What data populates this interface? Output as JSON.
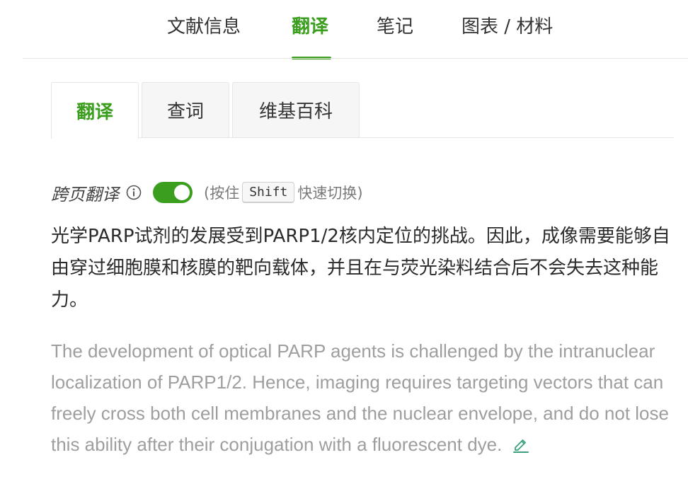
{
  "top_tabs": {
    "items": [
      {
        "label": "文献信息"
      },
      {
        "label": "翻译"
      },
      {
        "label": "笔记"
      },
      {
        "label": "图表 / 材料"
      }
    ],
    "active_index": 1
  },
  "sub_tabs": {
    "items": [
      {
        "label": "翻译"
      },
      {
        "label": "查词"
      },
      {
        "label": "维基百科"
      }
    ],
    "active_index": 0
  },
  "cross_page": {
    "label": "跨页翻译",
    "enabled": true,
    "hint_prefix": "(按住",
    "key": "Shift",
    "hint_suffix": "快速切换)"
  },
  "translation": {
    "chinese": "光学PARP试剂的发展受到PARP1/2核内定位的挑战。因此，成像需要能够自由穿过细胞膜和核膜的靶向载体，并且在与荧光染料结合后不会失去这种能力。",
    "english": "The development of optical PARP agents is challenged by the intranuclear localization of PARP1/2. Hence, imaging requires targeting vectors that can freely cross both cell membranes and the nuclear envelope, and do not lose this ability after their conjugation with a fluorescent dye."
  },
  "icons": {
    "info": "info-circle-icon",
    "edit": "pencil-icon"
  },
  "colors": {
    "accent": "#3c9e1f",
    "original_text": "#9e9e9e",
    "translated_text": "#2b2b2b"
  }
}
